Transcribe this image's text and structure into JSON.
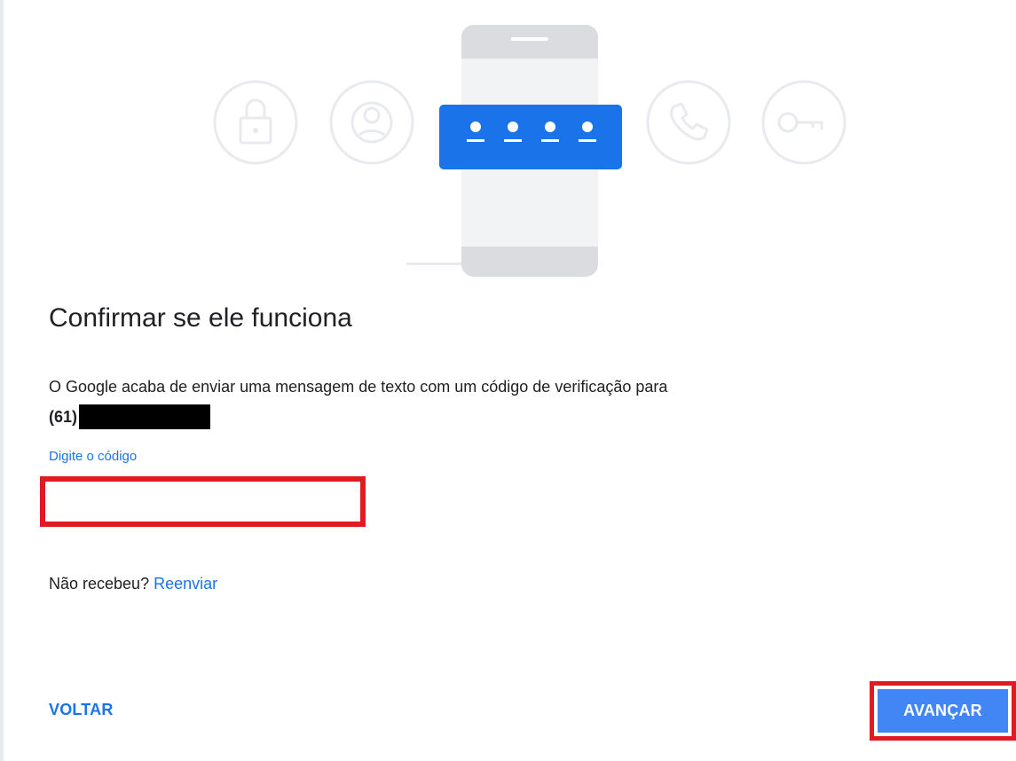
{
  "illustration": {
    "icons": [
      "lock-icon",
      "account-circle-icon",
      "phone-icon",
      "key-icon"
    ],
    "code_dots": 4,
    "accent_color": "#1a73e8",
    "icon_stroke_color": "#e8eaed"
  },
  "main": {
    "title": "Confirmar se ele funciona",
    "description": "O Google acaba de enviar uma mensagem de texto com um código de verificação para",
    "phone_prefix": "(61)"
  },
  "code_field": {
    "label": "Digite o código",
    "value": "",
    "placeholder": ""
  },
  "resend": {
    "question": "Não recebeu?",
    "link": "Reenviar"
  },
  "actions": {
    "back_label": "VOLTAR",
    "next_label": "AVANÇAR"
  },
  "colors": {
    "link": "#1a73e8",
    "primary_button": "#4285f4",
    "highlight": "#e21b23"
  }
}
